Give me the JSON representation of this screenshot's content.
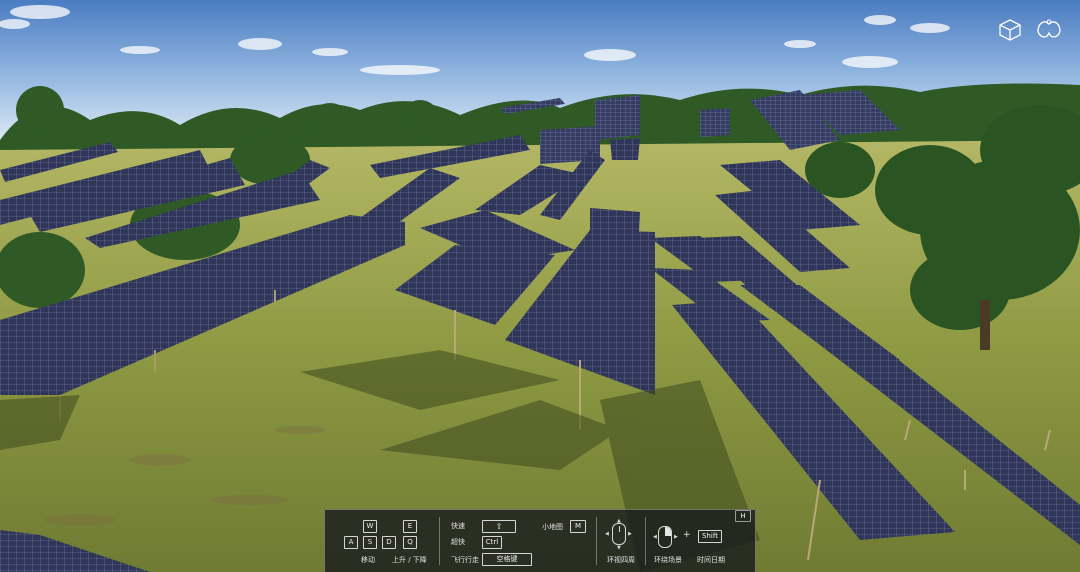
{
  "colors": {
    "sky_top": "#4d7fc4",
    "sky_bottom": "#cddff0",
    "grass": "#8a9a3c",
    "panel": "#2e3557",
    "hint_bg": "#16181c"
  },
  "top_icons": [
    "cube-icon",
    "angel-wings-icon"
  ],
  "hint_panel": {
    "corner_key": "H",
    "move": {
      "keys_top": [
        "W",
        "E"
      ],
      "keys_bottom": [
        "A",
        "S",
        "D",
        "Q"
      ],
      "label_move": "移动",
      "label_updown": "上升 / 下降"
    },
    "speed": {
      "fast_label": "快速",
      "fast_key": "⇧",
      "superfast_label": "超快",
      "superfast_key": "Ctrl",
      "fly_label": "飞行行走",
      "fly_key": "空格键",
      "minimap_label": "小地图",
      "minimap_key": "M"
    },
    "look": {
      "label": "环视四周"
    },
    "orbit": {
      "plus": "+",
      "shift_key": "Shift",
      "label_orbit": "环绕场景",
      "label_time": "时间日期"
    }
  }
}
